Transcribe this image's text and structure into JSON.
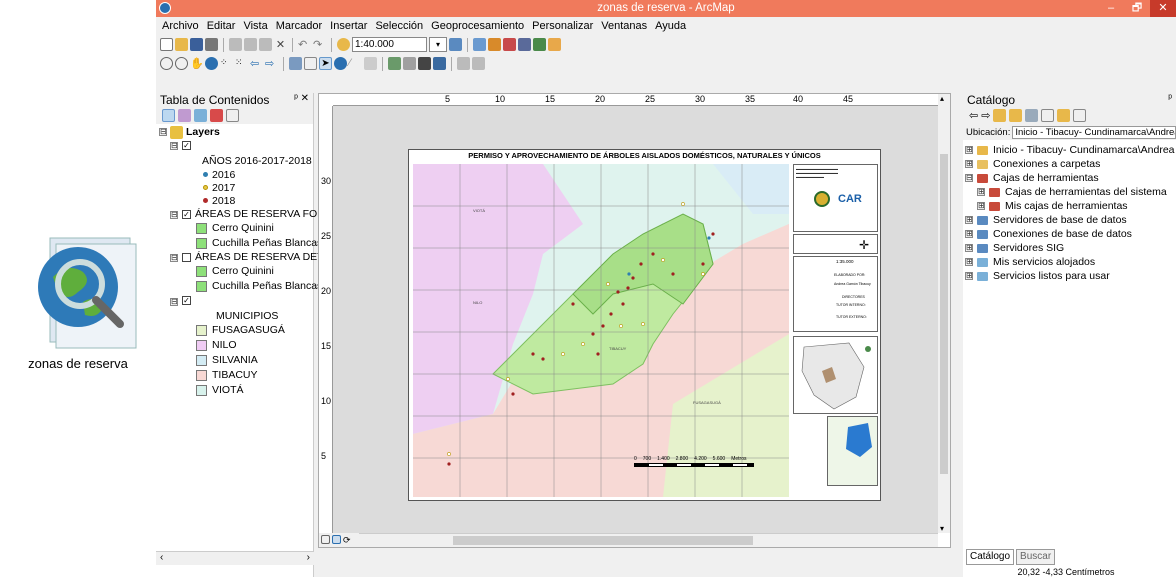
{
  "desktop": {
    "icon_label": "zonas de reserva"
  },
  "window": {
    "title": "zonas de reserva - ArcMap",
    "minimize": "–",
    "maximize": "🗗",
    "close": "✕"
  },
  "menu": [
    "Archivo",
    "Editar",
    "Vista",
    "Marcador",
    "Insertar",
    "Selección",
    "Geoprocesamiento",
    "Personalizar",
    "Ventanas",
    "Ayuda"
  ],
  "toolbar": {
    "scale": "1:40.000"
  },
  "toc": {
    "title": "Tabla de Contenidos",
    "pin": "ᵖ ✕",
    "layers": "Layers",
    "years_header": "AÑOS 2016-2017-2018",
    "years": [
      {
        "label": "2016",
        "color": "#2f7fb0"
      },
      {
        "label": "2017",
        "color": "#e6c84a"
      },
      {
        "label": "2018",
        "color": "#b02a2a"
      }
    ],
    "group1": "ÁREAS DE RESERVA FOREST",
    "group1_items": [
      "Cerro Quinini",
      "Cuchilla Peñas Blancas"
    ],
    "group2": "ÁREAS DE RESERVA DETALL",
    "group2_items": [
      "Cerro Quinini",
      "Cuchilla Peñas Blancas"
    ],
    "municipios_header": "MUNICIPIOS",
    "municipios": [
      {
        "label": "FUSAGASUGÁ",
        "color": "#e6f2cc"
      },
      {
        "label": "NILO",
        "color": "#f0ccf4"
      },
      {
        "label": "SILVANIA",
        "color": "#d4ecf4"
      },
      {
        "label": "TIBACUY",
        "color": "#f8d8d4"
      },
      {
        "label": "VIOTÁ",
        "color": "#d8f2ec"
      }
    ]
  },
  "ruler": {
    "h": [
      "5",
      "10",
      "15",
      "20",
      "25",
      "30",
      "35",
      "40",
      "45"
    ],
    "v": [
      "30",
      "25",
      "20",
      "15",
      "10",
      "5"
    ]
  },
  "map": {
    "title": "PERMISO Y APROVECHAMIENTO DE ÁRBOLES AISLADOS DOMÉSTICOS, NATURALES Y ÚNICOS",
    "car_label": "CAR",
    "scale_text": "1:35.000",
    "elaborado_label": "ELABORADO POR:",
    "elaborado_name": "Andrea Gamón Tibacuy",
    "directores_label": "DIRECTORES",
    "tutor_interno": "TUTOR INTERNO:",
    "tutor_externo": "TUTOR EXTERNO:",
    "scalebar": [
      "0",
      "700",
      "1.400",
      "2.800",
      "4.200",
      "5.600"
    ],
    "scalebar_units": "Metros",
    "labels": {
      "viota": "VIOTÁ",
      "nilo": "NILO",
      "tibacuy": "TIBACUY",
      "fusa": "FUSAGASUGÁ"
    }
  },
  "catalog": {
    "title": "Catálogo",
    "ubicacion_label": "Ubicación:",
    "ubicacion_value": "Inicio - Tibacuy- Cundinamarca\\Andrea",
    "items": [
      {
        "label": "Inicio - Tibacuy- Cundinamarca\\Andrea",
        "indent": 0,
        "exp": "⊞"
      },
      {
        "label": "Conexiones a carpetas",
        "indent": 0,
        "exp": "⊞"
      },
      {
        "label": "Cajas de herramientas",
        "indent": 0,
        "exp": "⊟"
      },
      {
        "label": "Cajas de herramientas del sistema",
        "indent": 1,
        "exp": "⊞"
      },
      {
        "label": "Mis cajas de herramientas",
        "indent": 1,
        "exp": "⊞"
      },
      {
        "label": "Servidores de base de datos",
        "indent": 0,
        "exp": "⊞"
      },
      {
        "label": "Conexiones de base de datos",
        "indent": 0,
        "exp": "⊞"
      },
      {
        "label": "Servidores SIG",
        "indent": 0,
        "exp": "⊞"
      },
      {
        "label": "Mis servicios alojados",
        "indent": 0,
        "exp": "⊞"
      },
      {
        "label": "Servicios listos para usar",
        "indent": 0,
        "exp": "⊞"
      }
    ],
    "tab1": "Catálogo",
    "tab2": "Buscar"
  },
  "status": {
    "coords": "20,32  -4,33 Centímetros"
  }
}
